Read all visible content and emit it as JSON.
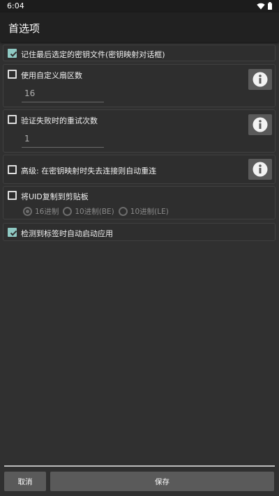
{
  "status_bar": {
    "time": "6:04"
  },
  "app_bar": {
    "title": "首选项"
  },
  "preferences": {
    "remember_key_file": {
      "label": "记住最后选定的密钥文件(密钥映射对话框)",
      "checked": true
    },
    "custom_sectors": {
      "label": "使用自定义扇区数",
      "checked": false,
      "value": "16"
    },
    "retry_count": {
      "label": "验证失败时的重试次数",
      "checked": false,
      "value": "1"
    },
    "auto_reconnect": {
      "label": "高级: 在密钥映射时失去连接则自动重连",
      "checked": false
    },
    "copy_uid": {
      "label": "将UID复制到剪贴板",
      "checked": false,
      "options": [
        "16进制",
        "10进制(BE)",
        "10进制(LE)"
      ],
      "selected": "16进制"
    },
    "auto_start": {
      "label": "检测到标签时自动启动应用",
      "checked": true
    }
  },
  "actions": {
    "cancel": "取消",
    "save": "保存"
  }
}
